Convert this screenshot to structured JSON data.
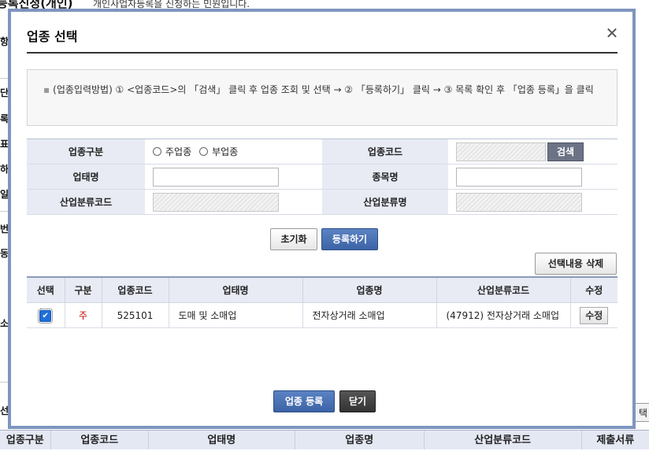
{
  "background": {
    "title": "등록신청(개인)",
    "description": "개인사업자등록을 신청하는 민원입니다.",
    "side_fragments": [
      "항",
      "단",
      "록",
      "표",
      "하",
      "일",
      "번",
      "동",
      "소",
      "선"
    ],
    "right_button": "택",
    "table_headers": [
      "업종구분",
      "업종코드",
      "업태명",
      "업종명",
      "산업분류코드",
      "제출서류"
    ]
  },
  "modal": {
    "title": "업종 선택",
    "close_icon": "close-icon",
    "notice": "(업종입력방법) ① <업종코드>의 「검색」 클릭 후 업종 조회 및 선택 → ② 「등록하기」 클릭 → ③ 목록 확인 후 「업종 등록」을 클릭",
    "form": {
      "type_label": "업종구분",
      "type_options": [
        "주업종",
        "부업종"
      ],
      "code_label": "업종코드",
      "code_value": "",
      "search_label": "검색",
      "business_label": "업태명",
      "business_value": "",
      "item_label": "종목명",
      "item_value": "",
      "ind_code_label": "산업분류코드",
      "ind_code_value": "",
      "ind_name_label": "산업분류명",
      "ind_name_value": ""
    },
    "buttons": {
      "reset": "초기화",
      "register": "등록하기",
      "delete_selected": "선택내용 삭제",
      "submit": "업종 등록",
      "close": "닫기"
    },
    "table": {
      "headers": [
        "선택",
        "구분",
        "업종코드",
        "업태명",
        "업종명",
        "산업분류코드",
        "수정"
      ],
      "rows": [
        {
          "checked": true,
          "type": "주",
          "code": "525101",
          "business": "도매 및 소매업",
          "item": "전자상거래 소매업",
          "ind_code": "(47912) 전자상거래 소매업",
          "edit": "수정"
        }
      ]
    },
    "colors": {
      "accent": "#3c63a5",
      "border": "#7e95bf",
      "label_bg": "#e8ebf4",
      "main_mark": "#c00000"
    }
  }
}
